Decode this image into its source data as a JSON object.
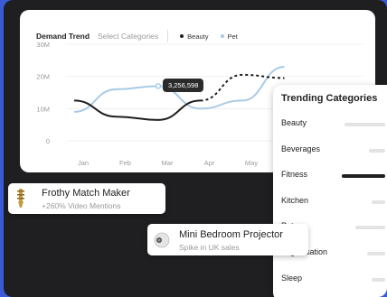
{
  "chart": {
    "title": "Demand Trend",
    "select": "Select Categories",
    "tooltip": "3,256,598",
    "colors": {
      "beauty": "#1f1f1f",
      "pet": "#a9cbe6"
    }
  },
  "chart_data": {
    "type": "line",
    "categories": [
      "Jan",
      "Feb",
      "Mar",
      "Apr",
      "May"
    ],
    "y_ticks": [
      "30M",
      "20M",
      "10M",
      "0"
    ],
    "ylim": [
      0,
      30
    ],
    "series": [
      {
        "name": "Beauty",
        "values": [
          12.5,
          7.5,
          6.5,
          12.5,
          20.5,
          19.5
        ]
      },
      {
        "name": "Pet",
        "values": [
          9,
          16,
          17,
          10,
          12.5,
          23
        ]
      }
    ],
    "x_positions": [
      0,
      1,
      2,
      3,
      4,
      5
    ],
    "grid": true,
    "legend": "top"
  },
  "trending": {
    "title": "Trending Categories",
    "items": [
      {
        "label": "Beauty",
        "active": false,
        "bar_fill": 0.9
      },
      {
        "label": "Beverages",
        "active": false,
        "bar_fill": 0.35
      },
      {
        "label": "Fitness",
        "active": true,
        "bar_fill": 0.95
      },
      {
        "label": "Kitchen",
        "active": false,
        "bar_fill": 0.3
      },
      {
        "label": "Pet",
        "active": false,
        "bar_fill": 0.65
      },
      {
        "label": "Organisation",
        "active": false,
        "bar_fill": 0.4
      },
      {
        "label": "Sleep",
        "active": false,
        "bar_fill": 0.3
      }
    ]
  },
  "products": [
    {
      "name": "Frothy Match Maker",
      "sub": "+260% Video Mentions",
      "icon": "frother-icon"
    },
    {
      "name": "Mini Bedroom Projector",
      "sub": "Spike in UK sales",
      "icon": "projector-icon"
    }
  ]
}
